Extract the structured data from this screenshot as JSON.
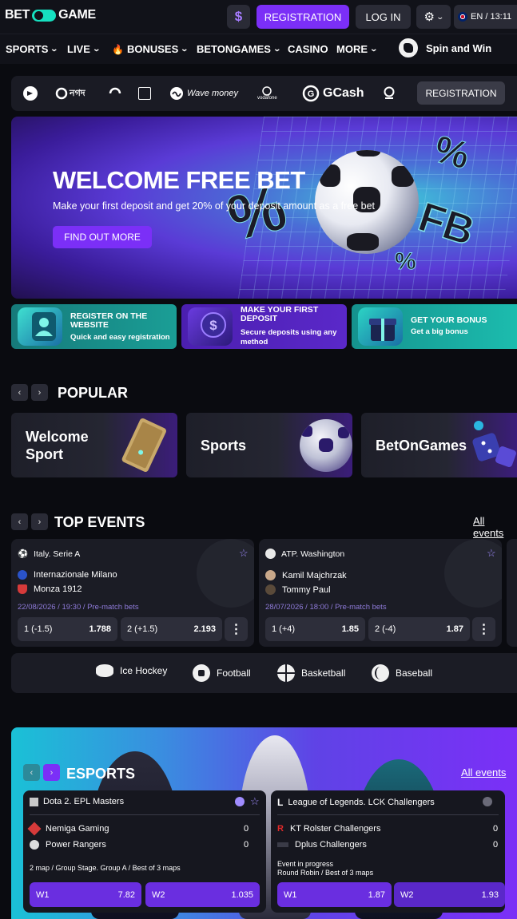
{
  "header": {
    "logo_left": "BET",
    "logo_right": "GAME",
    "dollar": "$",
    "registration": "REGISTRATION",
    "login": "LOG IN",
    "lang": "EN / 13:11"
  },
  "nav": {
    "items": [
      "SPORTS",
      "LIVE",
      "BONUSES",
      "BETONGAMES",
      "CASINO",
      "MORE"
    ],
    "spin": "Spin and Win"
  },
  "payments": {
    "logos": [
      "নগদ",
      "Wave money",
      "vodafone",
      "GCash"
    ],
    "registration": "REGISTRATION"
  },
  "hero": {
    "title": "WELCOME FREE BET",
    "subtitle": "Make your first deposit and get 20% of your deposit amount as a free bet",
    "button": "FIND OUT MORE",
    "decor_text": "FB",
    "decor_pct": "%"
  },
  "steps": [
    {
      "title": "REGISTER ON THE WEBSITE",
      "sub": "Quick and easy registration"
    },
    {
      "title": "MAKE YOUR FIRST DEPOSIT",
      "sub": "Secure deposits using any method"
    },
    {
      "title": "GET YOUR BONUS",
      "sub": "Get a big bonus"
    }
  ],
  "popular": {
    "title": "POPULAR",
    "cards": [
      {
        "line1": "Welcome",
        "line2": "Sport"
      },
      {
        "line1": "Sports",
        "line2": ""
      },
      {
        "line1": "BetOnGames",
        "line2": ""
      }
    ]
  },
  "top_events": {
    "title": "TOP EVENTS",
    "all_events": "All events",
    "events": [
      {
        "league": "Italy. Serie A",
        "team1": "Internazionale Milano",
        "team2": "Monza 1912",
        "meta": "22/08/2026 / 19:30 / Pre-match bets",
        "odd1_label": "1 (-1.5)",
        "odd1_value": "1.788",
        "odd2_label": "2 (+1.5)",
        "odd2_value": "2.193"
      },
      {
        "league": "ATP. Washington",
        "team1": "Kamil Majchrzak",
        "team2": "Tommy Paul",
        "meta": "28/07/2026 / 18:00 / Pre-match bets",
        "odd1_label": "1 (+4)",
        "odd1_value": "1.85",
        "odd2_label": "2 (-4)",
        "odd2_value": "1.87"
      }
    ],
    "more": "⋮"
  },
  "sport_tabs": [
    "Ice Hockey",
    "Football",
    "Basketball",
    "Baseball"
  ],
  "esports": {
    "title": "ESPORTS",
    "all_events": "All events",
    "matches": [
      {
        "league": "Dota 2. EPL Masters",
        "team1": "Nemiga Gaming",
        "score1": "0",
        "team2": "Power Rangers",
        "score2": "0",
        "status": "",
        "info": "2 map / Group Stage. Group A / Best of 3 maps",
        "w1_label": "W1",
        "w1_value": "7.82",
        "w2_label": "W2",
        "w2_value": "1.035"
      },
      {
        "league": "League of Legends. LCK Challengers",
        "team1": "KT Rolster Challengers",
        "score1": "0",
        "team2": "Dplus Challengers",
        "score2": "0",
        "status": "Event in progress",
        "info": "Round Robin / Best of 3 maps",
        "w1_label": "W1",
        "w1_value": "1.87",
        "w2_label": "W2",
        "w2_value": "1.93"
      }
    ]
  },
  "colors": {
    "accent": "#7b2ff7",
    "teal": "#16e0c0",
    "card": "#1b1c25"
  }
}
